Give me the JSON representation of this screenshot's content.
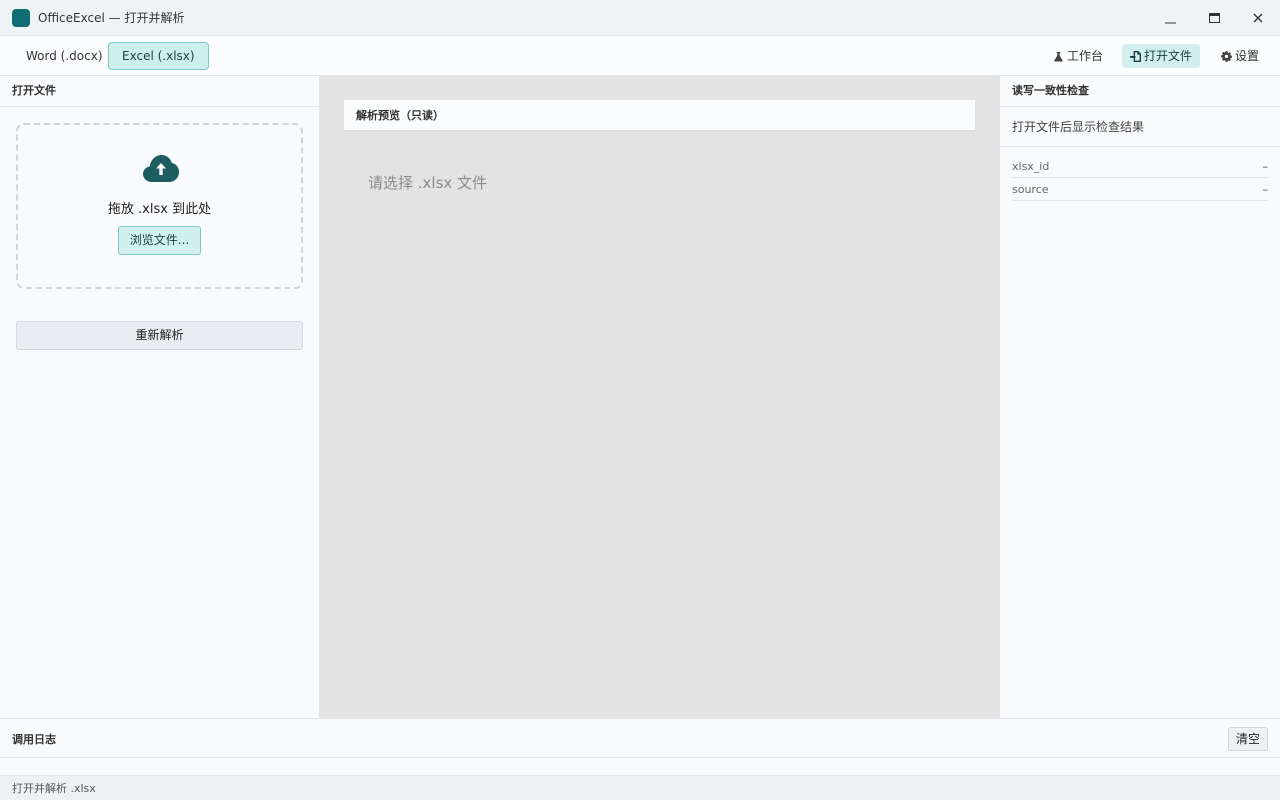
{
  "window": {
    "title": "OfficeExcel — 打开并解析",
    "minimize_glyph": "—",
    "maximize_glyph": "□",
    "close_glyph": "✕"
  },
  "toolbar": {
    "mode_tabs": [
      {
        "label": "Word (.docx)",
        "active": false
      },
      {
        "label": "Excel (.xlsx)",
        "active": true
      }
    ],
    "nav": [
      {
        "label": "工作台",
        "icon": "flask-icon",
        "active": false
      },
      {
        "label": "打开文件",
        "icon": "file-import-icon",
        "active": true
      },
      {
        "label": "设置",
        "icon": "gear-icon",
        "active": false
      }
    ]
  },
  "left_panel": {
    "title": "打开文件",
    "dropzone": {
      "icon": "cloud-upload-icon",
      "text": "拖放 .xlsx 到此处",
      "browse_label": "浏览文件..."
    },
    "reparse_label": "重新解析"
  },
  "center": {
    "preview_title": "解析预览（只读）",
    "empty_text": "请选择 .xlsx 文件"
  },
  "right_panel": {
    "title": "读写一致性检查",
    "message": "打开文件后显示检查结果",
    "fields": [
      {
        "key": "xlsx_id",
        "value": "–"
      },
      {
        "key": "source",
        "value": "–"
      }
    ]
  },
  "log": {
    "title": "调用日志",
    "clear_label": "清空"
  },
  "status": {
    "text": "打开并解析 .xlsx"
  },
  "colors": {
    "accent": "#0e6e73",
    "accent_light": "#d2eeee",
    "center_bg": "#e3e3e3"
  }
}
